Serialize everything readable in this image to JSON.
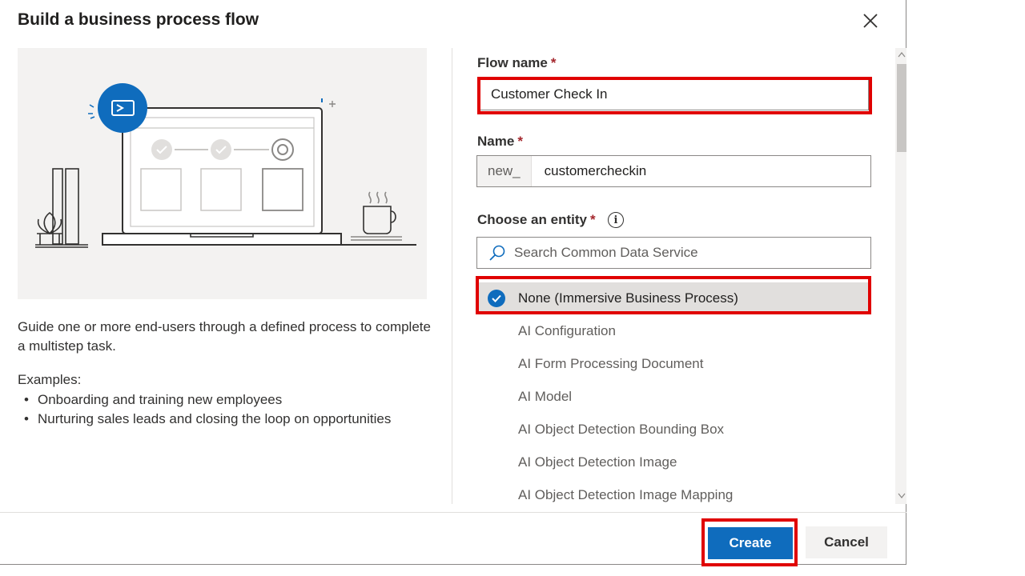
{
  "dialog": {
    "title": "Build a business process flow",
    "close_icon": "close-icon"
  },
  "left": {
    "description": "Guide one or more end-users through a defined process to complete a multistep task.",
    "examples_label": "Examples:",
    "examples": [
      "Onboarding and training new employees",
      "Nurturing sales leads and closing the loop on opportunities"
    ]
  },
  "form": {
    "flow_name_label": "Flow name",
    "flow_name_value": "Customer Check In",
    "name_label": "Name",
    "name_prefix": "new_",
    "name_value": "customercheckin",
    "entity_label": "Choose an entity",
    "required_mark": "*",
    "info_icon": "i",
    "search_placeholder": "Search Common Data Service",
    "entities": [
      "None (Immersive Business Process)",
      "AI Configuration",
      "AI Form Processing Document",
      "AI Model",
      "AI Object Detection Bounding Box",
      "AI Object Detection Image",
      "AI Object Detection Image Mapping"
    ],
    "selected_entity": "None (Immersive Business Process)"
  },
  "footer": {
    "create_label": "Create",
    "cancel_label": "Cancel"
  },
  "colors": {
    "primary": "#0f6cbd",
    "highlight": "#e00000",
    "required": "#a4262c"
  }
}
